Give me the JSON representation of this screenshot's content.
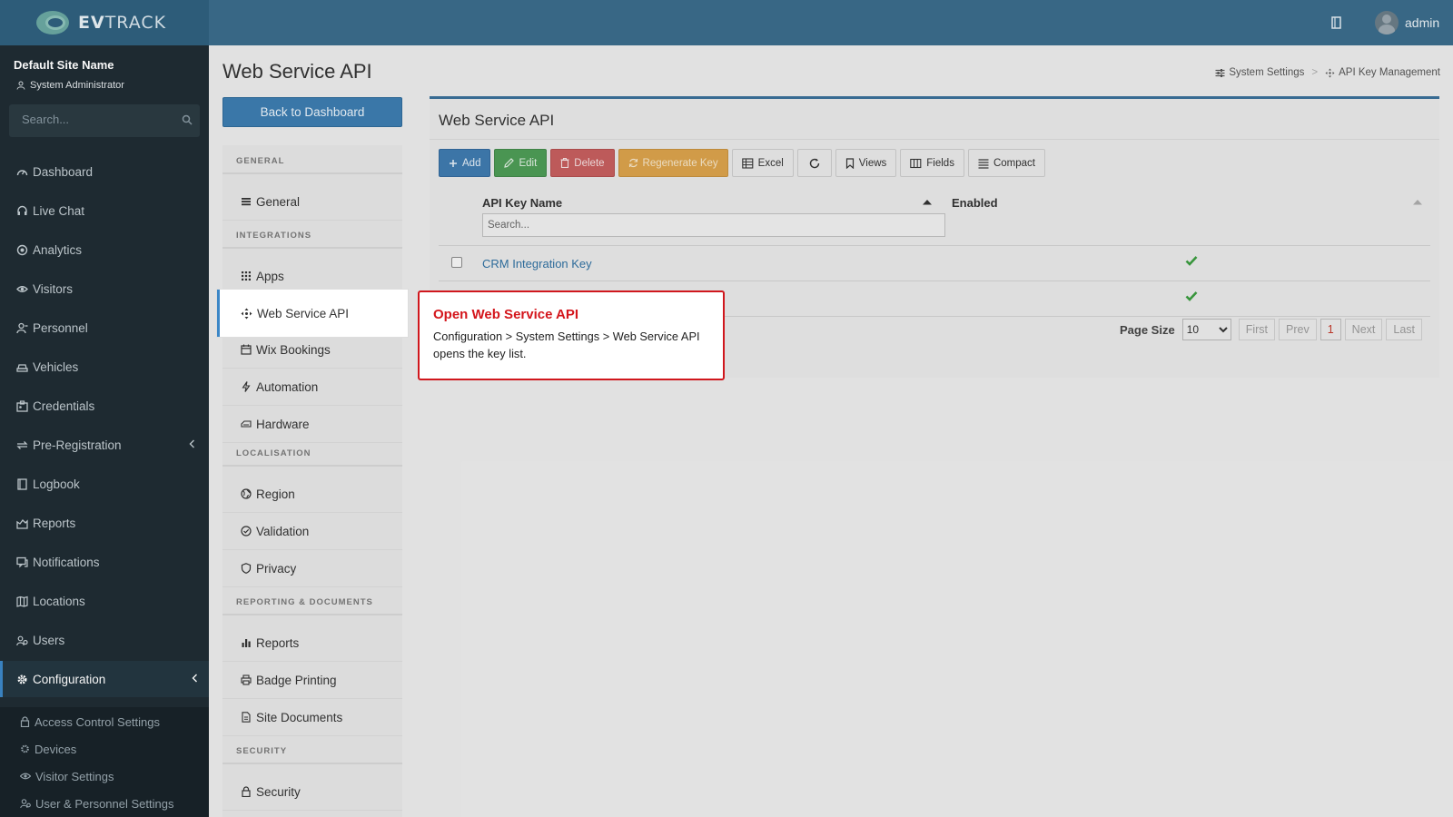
{
  "app": {
    "logo_text_bold": "EV",
    "logo_text": "TRACK"
  },
  "header": {
    "username": "admin"
  },
  "sidebar": {
    "site_name": "Default Site Name",
    "role": "System Administrator",
    "search_placeholder": "Search...",
    "items": [
      {
        "label": "Dashboard",
        "icon": "dashboard-icon"
      },
      {
        "label": "Live Chat",
        "icon": "headset-icon"
      },
      {
        "label": "Analytics",
        "icon": "target-icon"
      },
      {
        "label": "Visitors",
        "icon": "eye-icon"
      },
      {
        "label": "Personnel",
        "icon": "person-icon"
      },
      {
        "label": "Vehicles",
        "icon": "car-icon"
      },
      {
        "label": "Credentials",
        "icon": "id-card-icon"
      },
      {
        "label": "Pre-Registration",
        "icon": "arrows-icon"
      },
      {
        "label": "Logbook",
        "icon": "book-icon"
      },
      {
        "label": "Reports",
        "icon": "chart-icon"
      },
      {
        "label": "Notifications",
        "icon": "chat-icon"
      },
      {
        "label": "Locations",
        "icon": "map-icon"
      },
      {
        "label": "Users",
        "icon": "users-icon"
      },
      {
        "label": "Configuration",
        "icon": "gear-icon"
      }
    ],
    "sub_items": [
      {
        "label": "Access Control Settings",
        "icon": "lock-icon"
      },
      {
        "label": "Devices",
        "icon": "gear-icon"
      },
      {
        "label": "Visitor Settings",
        "icon": "eye-icon"
      },
      {
        "label": "User & Personnel Settings",
        "icon": "users-icon"
      }
    ]
  },
  "page": {
    "title": "Web Service API",
    "back_button": "Back to Dashboard",
    "breadcrumb": [
      "System Settings",
      "API Key Management"
    ]
  },
  "config_menu": {
    "sections": {
      "general": "GENERAL",
      "integrations": "INTEGRATIONS",
      "localisation": "LOCALISATION",
      "reporting": "REPORTING & DOCUMENTS",
      "security": "SECURITY"
    },
    "items": {
      "general": "General",
      "apps": "Apps",
      "web_service_api": "Web Service API",
      "wix_bookings": "Wix Bookings",
      "automation": "Automation",
      "hardware": "Hardware",
      "region": "Region",
      "validation": "Validation",
      "privacy": "Privacy",
      "reports": "Reports",
      "badge_printing": "Badge Printing",
      "site_documents": "Site Documents",
      "security": "Security"
    }
  },
  "panel": {
    "title": "Web Service API",
    "toolbar": {
      "add": "Add",
      "edit": "Edit",
      "delete": "Delete",
      "regenerate": "Regenerate Key",
      "excel": "Excel",
      "views": "Views",
      "fields": "Fields",
      "compact": "Compact"
    },
    "columns": {
      "name": "API Key Name",
      "enabled": "Enabled"
    },
    "column_search_placeholder": "Search...",
    "rows": [
      {
        "name": "CRM Integration Key",
        "enabled": true
      },
      {
        "name": "",
        "enabled": true
      }
    ],
    "pager": {
      "label": "Page Size",
      "page_size": "10",
      "first": "First",
      "prev": "Prev",
      "current": "1",
      "next": "Next",
      "last": "Last"
    }
  },
  "callout": {
    "title": "Open Web Service API",
    "body": "Configuration > System Settings > Web Service API opens the key list."
  },
  "colors": {
    "header": "#3a6b8a",
    "sidebar": "#1f2c33",
    "accent": "#3b86c6",
    "callout_border": "#d0171d"
  }
}
